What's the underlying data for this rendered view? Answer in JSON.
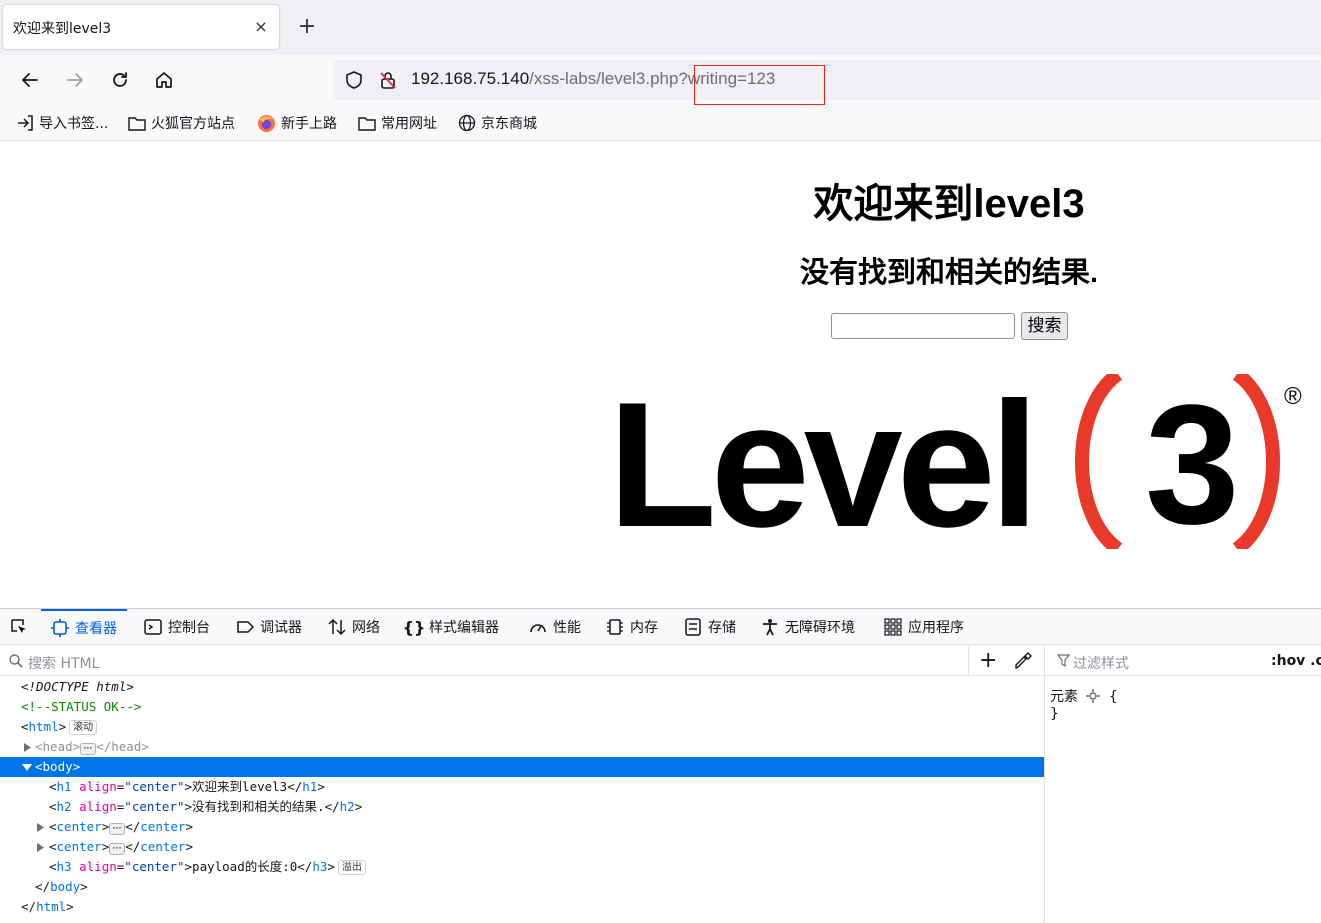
{
  "browser": {
    "tab_title": "欢迎来到level3",
    "tab_close": "×",
    "new_tab": "+",
    "url_host": "192.168.75.140",
    "url_rest": "/xss-labs/level3.php?writing=123"
  },
  "bookmarks": [
    {
      "label": "导入书签...",
      "icon": "import-icon"
    },
    {
      "label": "火狐官方站点",
      "icon": "folder-icon"
    },
    {
      "label": "新手上路",
      "icon": "firefox-icon"
    },
    {
      "label": "常用网址",
      "icon": "folder-icon"
    },
    {
      "label": "京东商城",
      "icon": "globe-icon"
    }
  ],
  "page": {
    "h1": "欢迎来到level3",
    "h2": "没有找到和相关的结果.",
    "search_button": "搜索",
    "search_value": "",
    "logo_text": "Level",
    "logo_number": "3",
    "logo_mark": "®"
  },
  "devtools": {
    "tabs": [
      {
        "label": "查看器",
        "active": true
      },
      {
        "label": "控制台"
      },
      {
        "label": "调试器"
      },
      {
        "label": "网络"
      },
      {
        "label": "样式编辑器"
      },
      {
        "label": "性能"
      },
      {
        "label": "内存"
      },
      {
        "label": "存储"
      },
      {
        "label": "无障碍环境"
      },
      {
        "label": "应用程序"
      }
    ],
    "search_placeholder": "搜索 HTML",
    "filter_placeholder": "过滤样式",
    "hov_label": ":hov .c",
    "rules": {
      "selector": "元素",
      "open": "{",
      "close": "}"
    },
    "markup": {
      "doctype": "<!DOCTYPE html>",
      "comment": "<!--STATUS OK-->",
      "html_open": "html",
      "scroll_badge": "滚动",
      "head": "head",
      "body": "body",
      "h1_tag": "h1",
      "h2_tag": "h2",
      "h3_tag": "h3",
      "center_tag": "center",
      "attr_align": "align",
      "attr_center": "\"center\"",
      "h1_text": "欢迎来到level3",
      "h2_text": "没有找到和相关的结果.",
      "h3_text": "payload的长度:0",
      "overflow_badge": "溢出"
    }
  }
}
